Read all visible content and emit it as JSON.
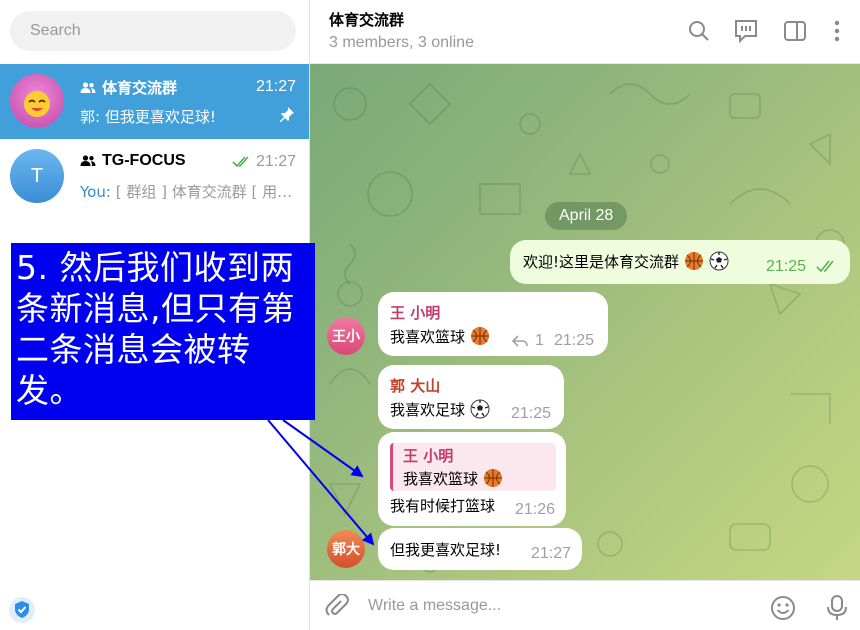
{
  "sidebar": {
    "search_placeholder": "Search",
    "chats": [
      {
        "name": "体育交流群",
        "time": "21:27",
        "preview": "郭: 但我更喜欢足球!",
        "type": "group",
        "pinned": true,
        "active": true
      },
      {
        "name": "TG-FOCUS",
        "avatar_letter": "T",
        "time": "21:27",
        "preview_prefix": "You:",
        "preview": "[ 群组 ] 体育交流群 [ 用…",
        "type": "group",
        "read_checks": true
      }
    ]
  },
  "header": {
    "title": "体育交流群",
    "subtitle": "3 members, 3 online",
    "icons": [
      "search-icon",
      "comment-icon",
      "sidebar-toggle-icon",
      "more-vertical-icon"
    ]
  },
  "chat": {
    "date_divider": "April 28",
    "messages": [
      {
        "direction": "out",
        "text": "欢迎!这里是体育交流群",
        "emoji": [
          "basketball",
          "soccer"
        ],
        "time": "21:25",
        "status": "read"
      },
      {
        "direction": "in",
        "sender": "王 小明",
        "avatar_label": "王小",
        "text": "我喜欢篮球",
        "emoji": [
          "basketball"
        ],
        "reply_count": "1",
        "time": "21:25"
      },
      {
        "direction": "in",
        "sender": "郭 大山",
        "text": "我喜欢足球",
        "emoji": [
          "soccer"
        ],
        "time": "21:25"
      },
      {
        "direction": "in",
        "quote_sender": "王 小明",
        "quote_text": "我喜欢篮球",
        "quote_emoji": [
          "basketball"
        ],
        "text": "我有时候打篮球",
        "time": "21:26"
      },
      {
        "direction": "in",
        "sender_avatar_label": "郭大",
        "text": "但我更喜欢足球!",
        "time": "21:27"
      }
    ]
  },
  "composer": {
    "placeholder": "Write a message...",
    "icons": [
      "attach-icon",
      "emoji-icon",
      "microphone-icon"
    ]
  },
  "annotation": {
    "text": "5. 然后我们收到两条新消息,但只有第二条消息会被转发。"
  },
  "colors": {
    "accent": "#419fd9",
    "annotation_bg": "#0000f0",
    "wang_name": "#c03d6a",
    "guo_name": "#c2432a",
    "out_bubble": "#effdde",
    "read_check": "#5db051"
  }
}
